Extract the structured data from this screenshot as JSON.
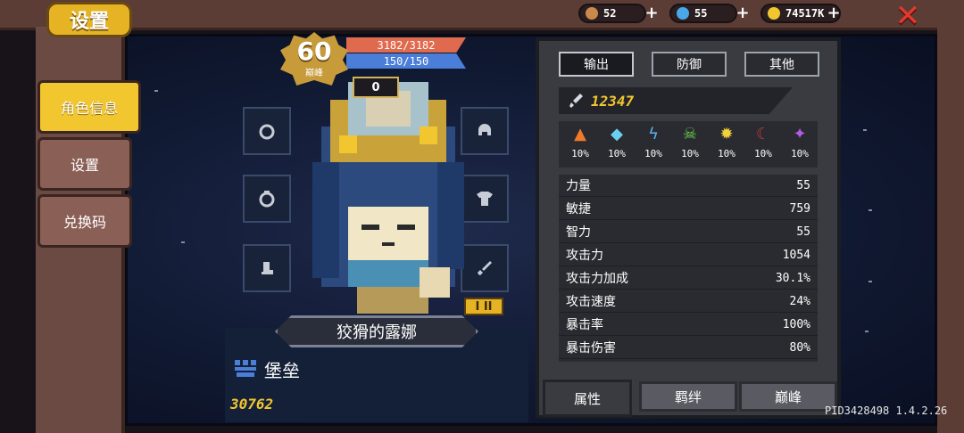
{
  "header": {
    "title": "设置",
    "resources": [
      {
        "name": "materials",
        "value": "52",
        "icon": "bag-icon",
        "color": "#c98a4b"
      },
      {
        "name": "gems",
        "value": "55",
        "icon": "gem-icon",
        "color": "#4aa8e8"
      },
      {
        "name": "coins",
        "value": "74517K",
        "icon": "coin-icon",
        "color": "#f2c62f"
      }
    ],
    "plus_label": "+",
    "close_label": "✕"
  },
  "sidebar": {
    "items": [
      {
        "label": "角色信息",
        "active": true
      },
      {
        "label": "设置",
        "active": false
      },
      {
        "label": "兑换码",
        "active": false
      }
    ]
  },
  "character": {
    "level": "60",
    "level_tag": "巅峰",
    "hp": "3182/3182",
    "mp": "150/150",
    "gem_count": "0",
    "name": "狡猾的露娜",
    "tier": "I II",
    "class_name": "堡垒",
    "power": "30762"
  },
  "stats_panel": {
    "tabs": [
      "输出",
      "防御",
      "其他"
    ],
    "active_tab": 0,
    "attack_power": "12347",
    "elements": [
      {
        "icon": "fire-icon",
        "glyph": "🔥",
        "color": "#f07a2a",
        "value": "10%"
      },
      {
        "icon": "ice-icon",
        "glyph": "◆",
        "color": "#6ad0f2",
        "value": "10%"
      },
      {
        "icon": "lightning-icon",
        "glyph": "ϟ",
        "color": "#5ab4f2",
        "value": "10%"
      },
      {
        "icon": "poison-icon",
        "glyph": "☠",
        "color": "#6ad24a",
        "value": "10%"
      },
      {
        "icon": "light-icon",
        "glyph": "✹",
        "color": "#f2d23a",
        "value": "10%"
      },
      {
        "icon": "dark-icon",
        "glyph": "☾",
        "color": "#c23a3a",
        "value": "10%"
      },
      {
        "icon": "arcane-icon",
        "glyph": "✦",
        "color": "#b45ae8",
        "value": "10%"
      }
    ],
    "rows": [
      {
        "label": "力量",
        "value": "55"
      },
      {
        "label": "敏捷",
        "value": "759"
      },
      {
        "label": "智力",
        "value": "55"
      },
      {
        "label": "攻击力",
        "value": "1054"
      },
      {
        "label": "攻击力加成",
        "value": "30.1%"
      },
      {
        "label": "攻击速度",
        "value": "24%"
      },
      {
        "label": "暴击率",
        "value": "100%"
      },
      {
        "label": "暴击伤害",
        "value": "80%"
      }
    ],
    "bottom_tabs": [
      "属性",
      "羁绊",
      "巅峰"
    ],
    "active_bottom_tab": 0
  },
  "footer": {
    "version": "PID3428498 1.4.2.26"
  }
}
